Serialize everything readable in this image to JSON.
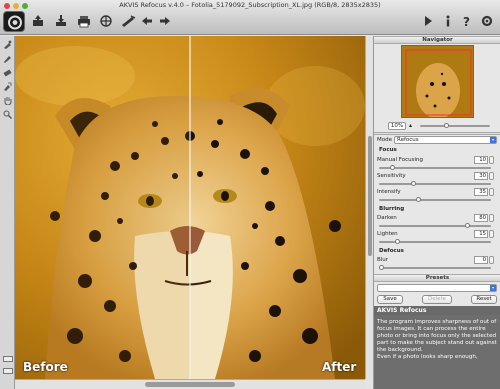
{
  "window": {
    "title": "AKVIS Refocus v.4.0 – Fotolia_5179092_Subscription_XL.jpg (RGB/8, 2835x2835)"
  },
  "toolbar": {
    "left_icons": [
      "app-logo-icon",
      "open-icon",
      "save-icon",
      "print-icon",
      "share-icon",
      "run-icon",
      "undo-icon",
      "redo-icon"
    ],
    "right_icons": [
      "run-arrow-icon",
      "info-icon",
      "help-icon",
      "preferences-icon"
    ]
  },
  "tools": [
    "focus-brush-icon",
    "brush-icon",
    "eraser-icon",
    "history-brush-icon",
    "hand-icon",
    "zoom-icon"
  ],
  "canvas": {
    "before_label": "Before",
    "after_label": "After"
  },
  "navigator": {
    "header": "Navigator",
    "zoom": "10%"
  },
  "settings": {
    "mode_label": "Mode",
    "mode_value": "Refocus",
    "focus_section": "Focus",
    "manual_focusing_label": "Manual Focusing",
    "manual_focusing_value": "10",
    "manual_focusing_level": 0.1,
    "sensitivity_label": "Sensitivity",
    "sensitivity_value": "30",
    "sensitivity_level": 0.3,
    "intensify_label": "Intensify",
    "intensify_value": "35",
    "intensify_level": 0.35,
    "blurring_section": "Blurring",
    "darken_label": "Darken",
    "darken_value": "80",
    "darken_level": 0.8,
    "lighten_label": "Lighten",
    "lighten_value": "15",
    "lighten_level": 0.15,
    "defocus_section": "Defocus",
    "blur_label": "Blur",
    "blur_value": "0",
    "blur_level": 0.0
  },
  "presets": {
    "header": "Presets",
    "save_label": "Save",
    "delete_label": "Delete",
    "reset_label": "Reset"
  },
  "info": {
    "title": "AKVIS Refocus",
    "text": "The program improves sharpness of out of focus images. It can process the entire photo or bring into focus only the selected part to make the subject stand out against the background.\nEven if a photo looks sharp enough,"
  }
}
